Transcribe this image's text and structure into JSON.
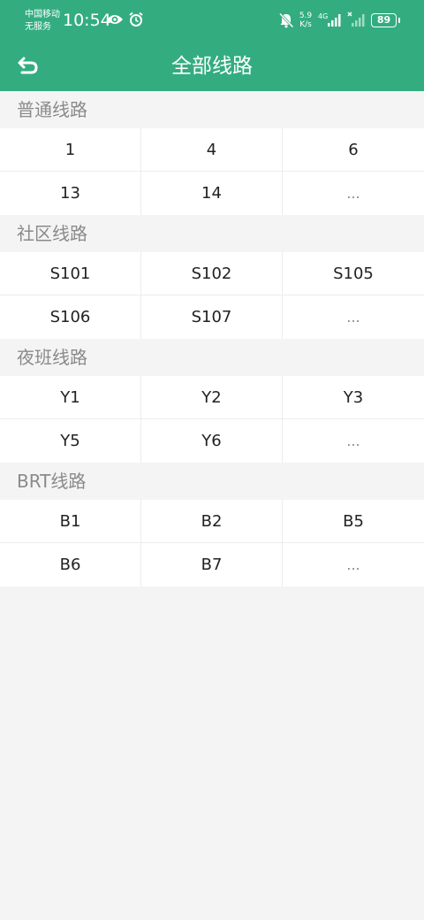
{
  "status_bar": {
    "carrier_line1": "中国移动",
    "carrier_line2": "无服务",
    "time": "10:54",
    "net_speed_value": "5.9",
    "net_speed_unit": "K/s",
    "network_type": "4G",
    "battery_level": "89",
    "icons": [
      "eye-icon",
      "alarm-icon",
      "mute-icon",
      "signal-icon",
      "battery-icon"
    ]
  },
  "app_bar": {
    "title": "全部线路",
    "back_icon": "back-arrow-icon"
  },
  "sections": [
    {
      "title": "普通线路",
      "rows": [
        [
          "1",
          "4",
          "6"
        ],
        [
          "13",
          "14",
          "..."
        ]
      ]
    },
    {
      "title": "社区线路",
      "rows": [
        [
          "S101",
          "S102",
          "S105"
        ],
        [
          "S106",
          "S107",
          "..."
        ]
      ]
    },
    {
      "title": "夜班线路",
      "rows": [
        [
          "Y1",
          "Y2",
          "Y3"
        ],
        [
          "Y5",
          "Y6",
          "..."
        ]
      ]
    },
    {
      "title": "BRT线路",
      "rows": [
        [
          "B1",
          "B2",
          "B5"
        ],
        [
          "B6",
          "B7",
          "..."
        ]
      ]
    }
  ],
  "colors": {
    "primary": "#33ad80",
    "background": "#f4f4f4",
    "section_header_text": "#8a8a8a"
  }
}
